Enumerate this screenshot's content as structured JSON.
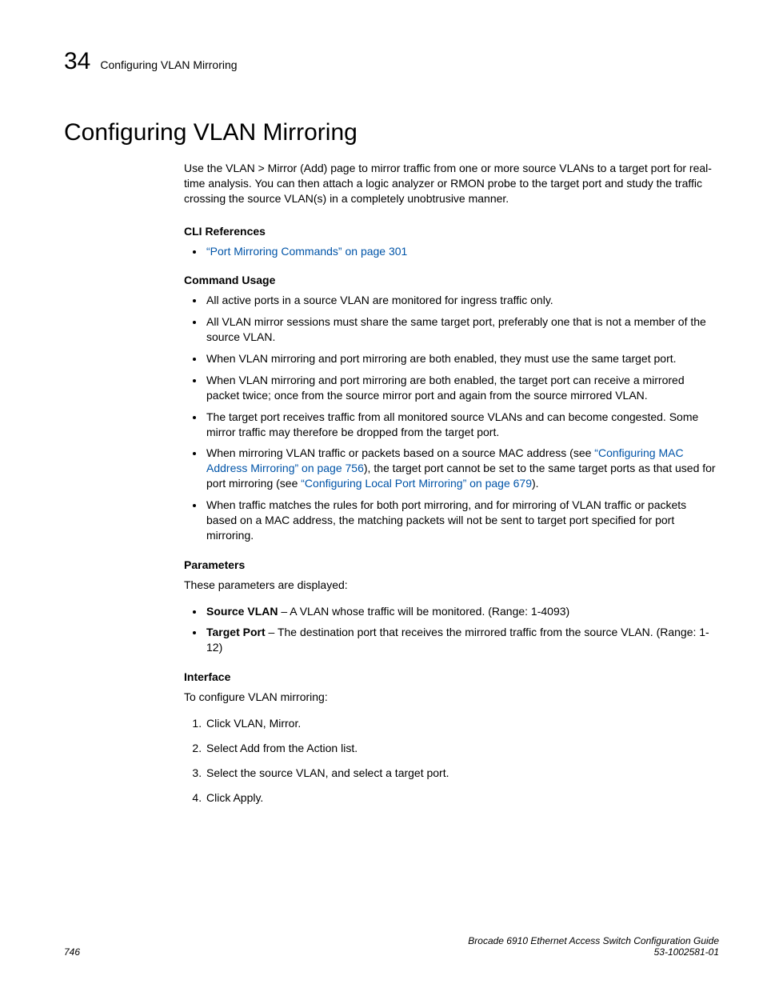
{
  "header": {
    "chapter_num": "34",
    "running_title": "Configuring VLAN Mirroring"
  },
  "title": "Configuring VLAN Mirroring",
  "intro": "Use the VLAN > Mirror (Add) page to mirror traffic from one or more source VLANs to a target port for real-time analysis. You can then attach a logic analyzer or RMON probe to the target port and study the traffic crossing the source VLAN(s) in a completely unobtrusive manner.",
  "cli_ref": {
    "label": "CLI References",
    "link_text": "“Port Mirroring Commands” on page 301"
  },
  "cmd_usage": {
    "label": "Command Usage",
    "items": {
      "i0": "All active ports in a source VLAN are monitored for ingress traffic only.",
      "i1": "All VLAN mirror sessions must share the same target port, preferably one that is not a member of the source VLAN.",
      "i2": "When VLAN mirroring and port mirroring are both enabled, they must use the same target port.",
      "i3": "When VLAN mirroring and port mirroring are both enabled, the target port can receive a mirrored packet twice; once from the source mirror port and again from the source mirrored VLAN.",
      "i4": "The target port receives traffic from all monitored source VLANs and can become congested. Some mirror traffic may therefore be dropped from the target port.",
      "i5": {
        "pre": "When mirroring VLAN traffic or packets based on a source MAC address (see ",
        "link1": "“Configuring MAC Address Mirroring” on page 756",
        "mid": "), the target port cannot be set to the same target ports as that used for port mirroring (see ",
        "link2": "“Configuring Local Port Mirroring” on page 679",
        "post": ")."
      },
      "i6": "When traffic matches the rules for both port mirroring, and for mirroring of VLAN traffic or packets based on a MAC address, the matching packets will not be sent to target port specified for port mirroring."
    }
  },
  "params": {
    "label": "Parameters",
    "intro": "These parameters are displayed:",
    "items": {
      "p0": {
        "name": "Source VLAN",
        "desc": " – A VLAN whose traffic will be monitored. (Range: 1-4093)"
      },
      "p1": {
        "name": "Target Port",
        "desc": " – The destination port that receives the mirrored traffic from the source VLAN. (Range: 1-12)"
      }
    }
  },
  "iface": {
    "label": "Interface",
    "intro": "To configure VLAN mirroring:",
    "steps": {
      "s0": "Click VLAN, Mirror.",
      "s1": "Select Add from the Action list.",
      "s2": "Select the source VLAN, and select a target port.",
      "s3": "Click Apply."
    }
  },
  "footer": {
    "page_num": "746",
    "book": "Brocade 6910 Ethernet Access Switch Configuration Guide",
    "doc_num": "53-1002581-01"
  }
}
